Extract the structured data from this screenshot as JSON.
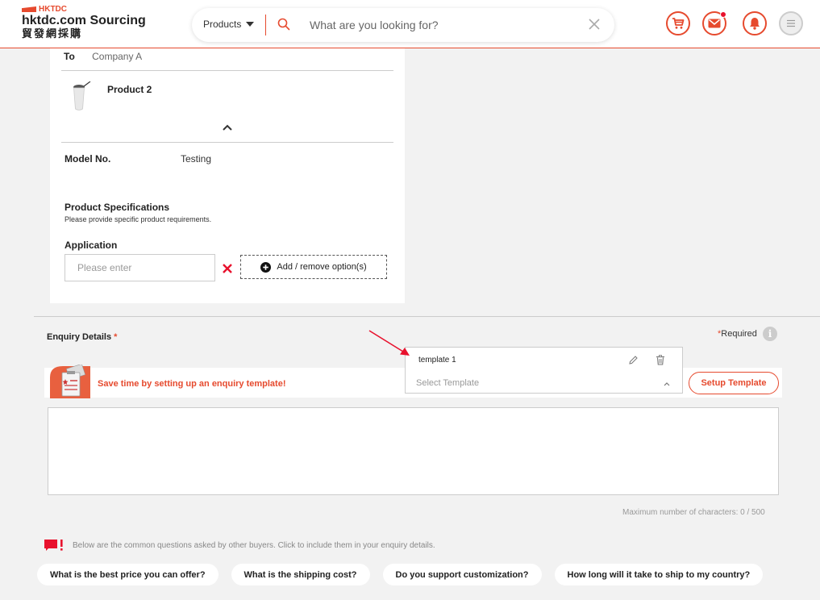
{
  "header": {
    "logo_top": "HKTDC",
    "logo_main": "hktdc.com Sourcing",
    "logo_sub": "貿發網採購",
    "search_category": "Products",
    "search_placeholder": "What are you looking for?"
  },
  "product_card": {
    "to_label": "To",
    "to_value": "Company A",
    "product_name": "Product 2",
    "model_label": "Model No.",
    "model_value": "Testing",
    "spec_title": "Product Specifications",
    "spec_hint": "Please provide specific product requirements.",
    "application_label": "Application",
    "application_placeholder": "Please enter",
    "add_option_label": "Add / remove option(s)"
  },
  "enquiry": {
    "title": "Enquiry Details",
    "required_star": "*",
    "required_note": "Required",
    "info_glyph": "i",
    "banner_text": "Save time by setting up an enquiry template!",
    "setup_button": "Setup Template",
    "template_option": "template 1",
    "template_select_placeholder": "Select Template",
    "char_count": "Maximum number of characters: 0 / 500",
    "questions_note": "Below are the common questions asked by other buyers. Click to include them in your enquiry details.",
    "questions": [
      "What is the best price you can offer?",
      "What is the shipping cost?",
      "Do you support customization?",
      "How long will it take to ship to my country?"
    ]
  },
  "colors": {
    "accent": "#e64a2e",
    "notification_dot": "#e8112d",
    "arrow": "#e8112d"
  }
}
